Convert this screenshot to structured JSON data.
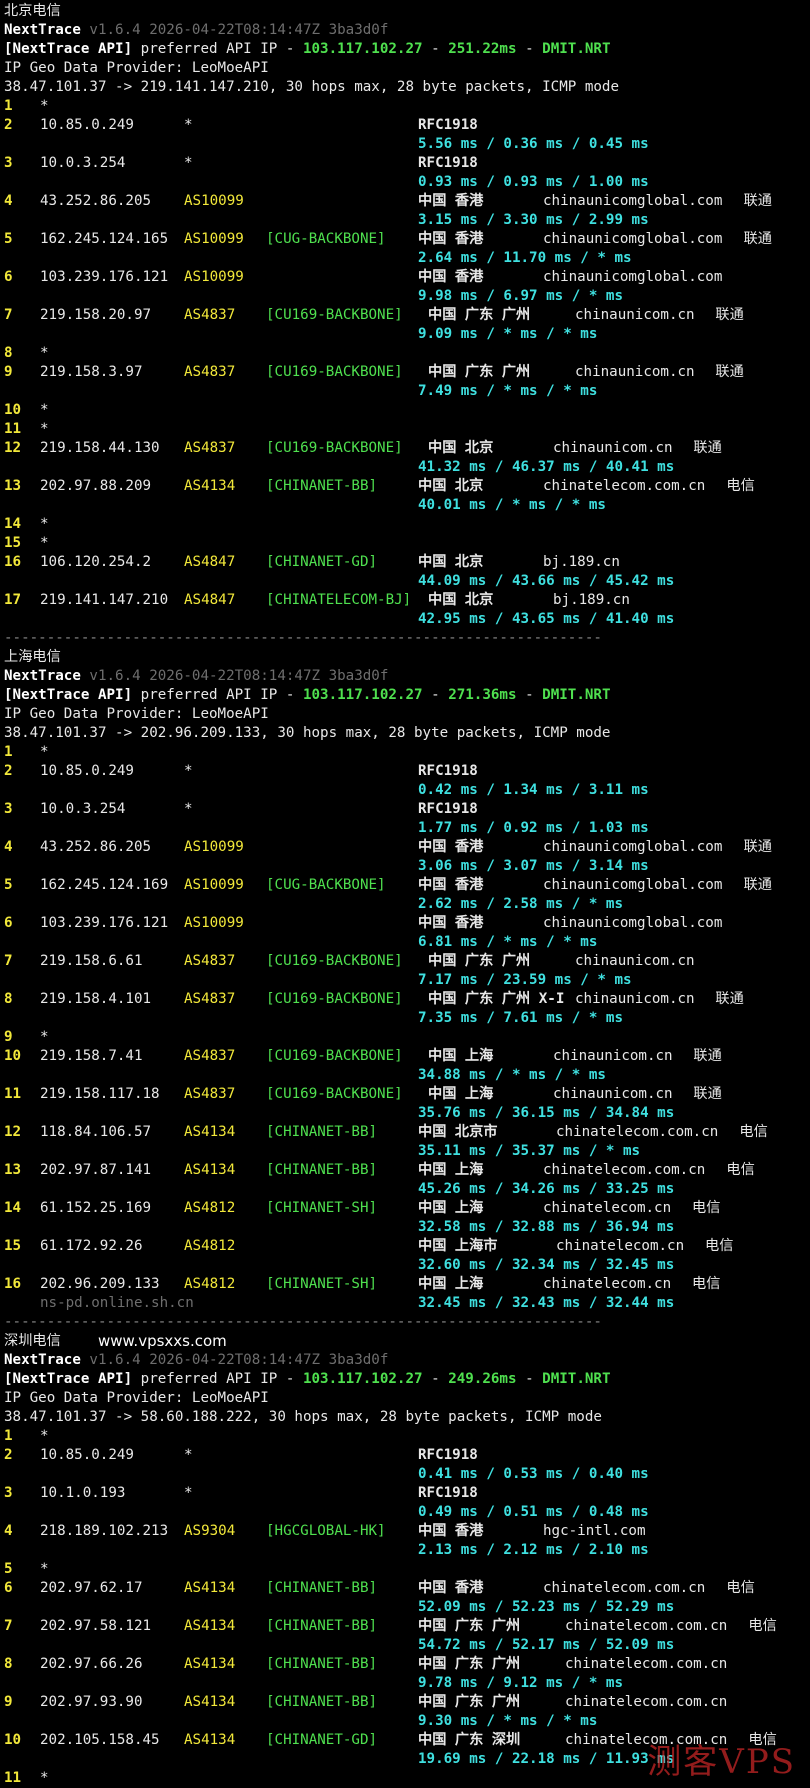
{
  "tool": {
    "name": "NextTrace",
    "version_line": "v1.6.4 2026-04-22T08:14:47Z 3ba3d0f",
    "api_prefix": "[NextTrace API]",
    "api_mid": " preferred API IP - ",
    "api_ip": "103.117.102.27",
    "api_sep": " - ",
    "api_suffix": "DMIT.NRT",
    "provider": "IP Geo Data Provider: LeoMoeAPI",
    "separator": "----------------------------------------------------------------------"
  },
  "sections": [
    {
      "title": "北京电信",
      "site": "",
      "api_latency": "251.22ms",
      "trace_line": "38.47.101.37 -> 219.141.147.210, 30 hops max, 28 byte packets, ICMP mode",
      "hops": [
        {
          "n": "1",
          "ip": "*",
          "asn": "",
          "tag": "",
          "geo": "",
          "domain": "",
          "isp": "",
          "rtt": ""
        },
        {
          "n": "2",
          "ip": "10.85.0.249",
          "asn": "*",
          "tag": "",
          "geo": "RFC1918",
          "domain": "",
          "isp": "",
          "rtt": "5.56 ms / 0.36 ms / 0.45 ms"
        },
        {
          "n": "3",
          "ip": "10.0.3.254",
          "asn": "*",
          "tag": "",
          "geo": "RFC1918",
          "domain": "",
          "isp": "",
          "rtt": "0.93 ms / 0.93 ms / 1.00 ms"
        },
        {
          "n": "4",
          "ip": "43.252.86.205",
          "asn": "AS10099",
          "tag": "",
          "geo": "中国 香港",
          "domain": "chinaunicomglobal.com",
          "isp": "联通",
          "rtt": "3.15 ms / 3.30 ms / 2.99 ms"
        },
        {
          "n": "5",
          "ip": "162.245.124.165",
          "asn": "AS10099",
          "tag": "[CUG-BACKBONE]",
          "geo": "中国 香港",
          "domain": "chinaunicomglobal.com",
          "isp": "联通",
          "rtt": "2.64 ms / 11.70 ms / * ms"
        },
        {
          "n": "6",
          "ip": "103.239.176.121",
          "asn": "AS10099",
          "tag": "",
          "geo": "中国 香港",
          "domain": "chinaunicomglobal.com",
          "isp": "",
          "rtt": "9.98 ms / 6.97 ms / * ms"
        },
        {
          "n": "7",
          "ip": "219.158.20.97",
          "asn": "AS4837",
          "tag": "[CU169-BACKBONE]",
          "geo": "中国 广东 广州",
          "domain": "chinaunicom.cn",
          "isp": "联通",
          "rtt": "9.09 ms / * ms / * ms"
        },
        {
          "n": "8",
          "ip": "*",
          "asn": "",
          "tag": "",
          "geo": "",
          "domain": "",
          "isp": "",
          "rtt": ""
        },
        {
          "n": "9",
          "ip": "219.158.3.97",
          "asn": "AS4837",
          "tag": "[CU169-BACKBONE]",
          "geo": "中国 广东 广州",
          "domain": "chinaunicom.cn",
          "isp": "联通",
          "rtt": "7.49 ms / * ms / * ms"
        },
        {
          "n": "10",
          "ip": "*",
          "asn": "",
          "tag": "",
          "geo": "",
          "domain": "",
          "isp": "",
          "rtt": ""
        },
        {
          "n": "11",
          "ip": "*",
          "asn": "",
          "tag": "",
          "geo": "",
          "domain": "",
          "isp": "",
          "rtt": ""
        },
        {
          "n": "12",
          "ip": "219.158.44.130",
          "asn": "AS4837",
          "tag": "[CU169-BACKBONE]",
          "geo": "中国 北京",
          "domain": "chinaunicom.cn",
          "isp": "联通",
          "rtt": "41.32 ms / 46.37 ms / 40.41 ms"
        },
        {
          "n": "13",
          "ip": "202.97.88.209",
          "asn": "AS4134",
          "tag": "[CHINANET-BB]",
          "geo": "中国 北京",
          "domain": "chinatelecom.com.cn",
          "isp": "电信",
          "rtt": "40.01 ms / * ms / * ms"
        },
        {
          "n": "14",
          "ip": "*",
          "asn": "",
          "tag": "",
          "geo": "",
          "domain": "",
          "isp": "",
          "rtt": ""
        },
        {
          "n": "15",
          "ip": "*",
          "asn": "",
          "tag": "",
          "geo": "",
          "domain": "",
          "isp": "",
          "rtt": ""
        },
        {
          "n": "16",
          "ip": "106.120.254.2",
          "asn": "AS4847",
          "tag": "[CHINANET-GD]",
          "geo": "中国 北京",
          "domain": "bj.189.cn",
          "isp": "",
          "rtt": "44.09 ms / 43.66 ms / 45.42 ms"
        },
        {
          "n": "17",
          "ip": "219.141.147.210",
          "asn": "AS4847",
          "tag": "[CHINATELECOM-BJ]",
          "geo": "中国 北京",
          "domain": "bj.189.cn",
          "isp": "",
          "rtt": "42.95 ms / 43.65 ms / 41.40 ms"
        }
      ]
    },
    {
      "title": "上海电信",
      "site": "",
      "api_latency": "271.36ms",
      "trace_line": "38.47.101.37 -> 202.96.209.133, 30 hops max, 28 byte packets, ICMP mode",
      "hops": [
        {
          "n": "1",
          "ip": "*",
          "asn": "",
          "tag": "",
          "geo": "",
          "domain": "",
          "isp": "",
          "rtt": ""
        },
        {
          "n": "2",
          "ip": "10.85.0.249",
          "asn": "*",
          "tag": "",
          "geo": "RFC1918",
          "domain": "",
          "isp": "",
          "rtt": "0.42 ms / 1.34 ms / 3.11 ms"
        },
        {
          "n": "3",
          "ip": "10.0.3.254",
          "asn": "*",
          "tag": "",
          "geo": "RFC1918",
          "domain": "",
          "isp": "",
          "rtt": "1.77 ms / 0.92 ms / 1.03 ms"
        },
        {
          "n": "4",
          "ip": "43.252.86.205",
          "asn": "AS10099",
          "tag": "",
          "geo": "中国 香港",
          "domain": "chinaunicomglobal.com",
          "isp": "联通",
          "rtt": "3.06 ms / 3.07 ms / 3.14 ms"
        },
        {
          "n": "5",
          "ip": "162.245.124.169",
          "asn": "AS10099",
          "tag": "[CUG-BACKBONE]",
          "geo": "中国 香港",
          "domain": "chinaunicomglobal.com",
          "isp": "联通",
          "rtt": "2.62 ms / 2.58 ms / * ms"
        },
        {
          "n": "6",
          "ip": "103.239.176.121",
          "asn": "AS10099",
          "tag": "",
          "geo": "中国 香港",
          "domain": "chinaunicomglobal.com",
          "isp": "",
          "rtt": "6.81 ms / * ms / * ms"
        },
        {
          "n": "7",
          "ip": "219.158.6.61",
          "asn": "AS4837",
          "tag": "[CU169-BACKBONE]",
          "geo": "中国 广东 广州",
          "domain": "chinaunicom.cn",
          "isp": "",
          "rtt": "7.17 ms / 23.59 ms / * ms"
        },
        {
          "n": "8",
          "ip": "219.158.4.101",
          "asn": "AS4837",
          "tag": "[CU169-BACKBONE]",
          "geo": "中国 广东 广州 X-I",
          "domain": "chinaunicom.cn",
          "isp": "联通",
          "rtt": "7.35 ms / 7.61 ms / * ms"
        },
        {
          "n": "9",
          "ip": "*",
          "asn": "",
          "tag": "",
          "geo": "",
          "domain": "",
          "isp": "",
          "rtt": ""
        },
        {
          "n": "10",
          "ip": "219.158.7.41",
          "asn": "AS4837",
          "tag": "[CU169-BACKBONE]",
          "geo": "中国 上海",
          "domain": "chinaunicom.cn",
          "isp": "联通",
          "rtt": "34.88 ms / * ms / * ms"
        },
        {
          "n": "11",
          "ip": "219.158.117.18",
          "asn": "AS4837",
          "tag": "[CU169-BACKBONE]",
          "geo": "中国 上海",
          "domain": "chinaunicom.cn",
          "isp": "联通",
          "rtt": "35.76 ms / 36.15 ms / 34.84 ms"
        },
        {
          "n": "12",
          "ip": "118.84.106.57",
          "asn": "AS4134",
          "tag": "[CHINANET-BB]",
          "geo": "中国 北京市",
          "domain": "chinatelecom.com.cn",
          "isp": "电信",
          "rtt": "35.11 ms / 35.37 ms / * ms"
        },
        {
          "n": "13",
          "ip": "202.97.87.141",
          "asn": "AS4134",
          "tag": "[CHINANET-BB]",
          "geo": "中国 上海",
          "domain": "chinatelecom.com.cn",
          "isp": "电信",
          "rtt": "45.26 ms / 34.26 ms / 33.25 ms"
        },
        {
          "n": "14",
          "ip": "61.152.25.169",
          "asn": "AS4812",
          "tag": "[CHINANET-SH]",
          "geo": "中国 上海",
          "domain": "chinatelecom.cn",
          "isp": "电信",
          "rtt": "32.58 ms / 32.88 ms / 36.94 ms"
        },
        {
          "n": "15",
          "ip": "61.172.92.26",
          "asn": "AS4812",
          "tag": "",
          "geo": "中国 上海市",
          "domain": "chinatelecom.cn",
          "isp": "电信",
          "rtt": "32.60 ms / 32.34 ms / 32.45 ms"
        },
        {
          "n": "16",
          "ip": "202.96.209.133",
          "asn": "AS4812",
          "tag": "[CHINANET-SH]",
          "geo": "中国 上海",
          "domain": "chinatelecom.cn",
          "isp": "电信",
          "rtt": "32.45 ms / 32.43 ms / 32.44 ms",
          "host": "ns-pd.online.sh.cn"
        }
      ]
    },
    {
      "title": "深圳电信",
      "site": "www.vpsxxs.com",
      "api_latency": "249.26ms",
      "trace_line": "38.47.101.37 -> 58.60.188.222, 30 hops max, 28 byte packets, ICMP mode",
      "hops": [
        {
          "n": "1",
          "ip": "*",
          "asn": "",
          "tag": "",
          "geo": "",
          "domain": "",
          "isp": "",
          "rtt": ""
        },
        {
          "n": "2",
          "ip": "10.85.0.249",
          "asn": "*",
          "tag": "",
          "geo": "RFC1918",
          "domain": "",
          "isp": "",
          "rtt": "0.41 ms / 0.53 ms / 0.40 ms"
        },
        {
          "n": "3",
          "ip": "10.1.0.193",
          "asn": "*",
          "tag": "",
          "geo": "RFC1918",
          "domain": "",
          "isp": "",
          "rtt": "0.49 ms / 0.51 ms / 0.48 ms"
        },
        {
          "n": "4",
          "ip": "218.189.102.213",
          "asn": "AS9304",
          "tag": "[HGCGLOBAL-HK]",
          "geo": "中国 香港",
          "domain": "hgc-intl.com",
          "isp": "",
          "rtt": "2.13 ms / 2.12 ms / 2.10 ms"
        },
        {
          "n": "5",
          "ip": "*",
          "asn": "",
          "tag": "",
          "geo": "",
          "domain": "",
          "isp": "",
          "rtt": ""
        },
        {
          "n": "6",
          "ip": "202.97.62.17",
          "asn": "AS4134",
          "tag": "[CHINANET-BB]",
          "geo": "中国 香港",
          "domain": "chinatelecom.com.cn",
          "isp": "电信",
          "rtt": "52.09 ms / 52.23 ms / 52.29 ms"
        },
        {
          "n": "7",
          "ip": "202.97.58.121",
          "asn": "AS4134",
          "tag": "[CHINANET-BB]",
          "geo": "中国 广东 广州",
          "domain": "chinatelecom.com.cn",
          "isp": "电信",
          "rtt": "54.72 ms / 52.17 ms / 52.09 ms"
        },
        {
          "n": "8",
          "ip": "202.97.66.26",
          "asn": "AS4134",
          "tag": "[CHINANET-BB]",
          "geo": "中国 广东 广州",
          "domain": "chinatelecom.com.cn",
          "isp": "",
          "rtt": "9.78 ms / 9.12 ms / * ms"
        },
        {
          "n": "9",
          "ip": "202.97.93.90",
          "asn": "AS4134",
          "tag": "[CHINANET-BB]",
          "geo": "中国 广东 广州",
          "domain": "chinatelecom.com.cn",
          "isp": "",
          "rtt": "9.30 ms / * ms / * ms"
        },
        {
          "n": "10",
          "ip": "202.105.158.45",
          "asn": "AS4134",
          "tag": "[CHINANET-GD]",
          "geo": "中国 广东 深圳",
          "domain": "chinatelecom.com.cn",
          "isp": "电信",
          "rtt": "19.69 ms / 22.18 ms / 11.93 ms"
        },
        {
          "n": "11",
          "ip": "*",
          "asn": "",
          "tag": "",
          "geo": "",
          "domain": "",
          "isp": "",
          "rtt": ""
        }
      ]
    }
  ],
  "watermark": "测客VPS"
}
